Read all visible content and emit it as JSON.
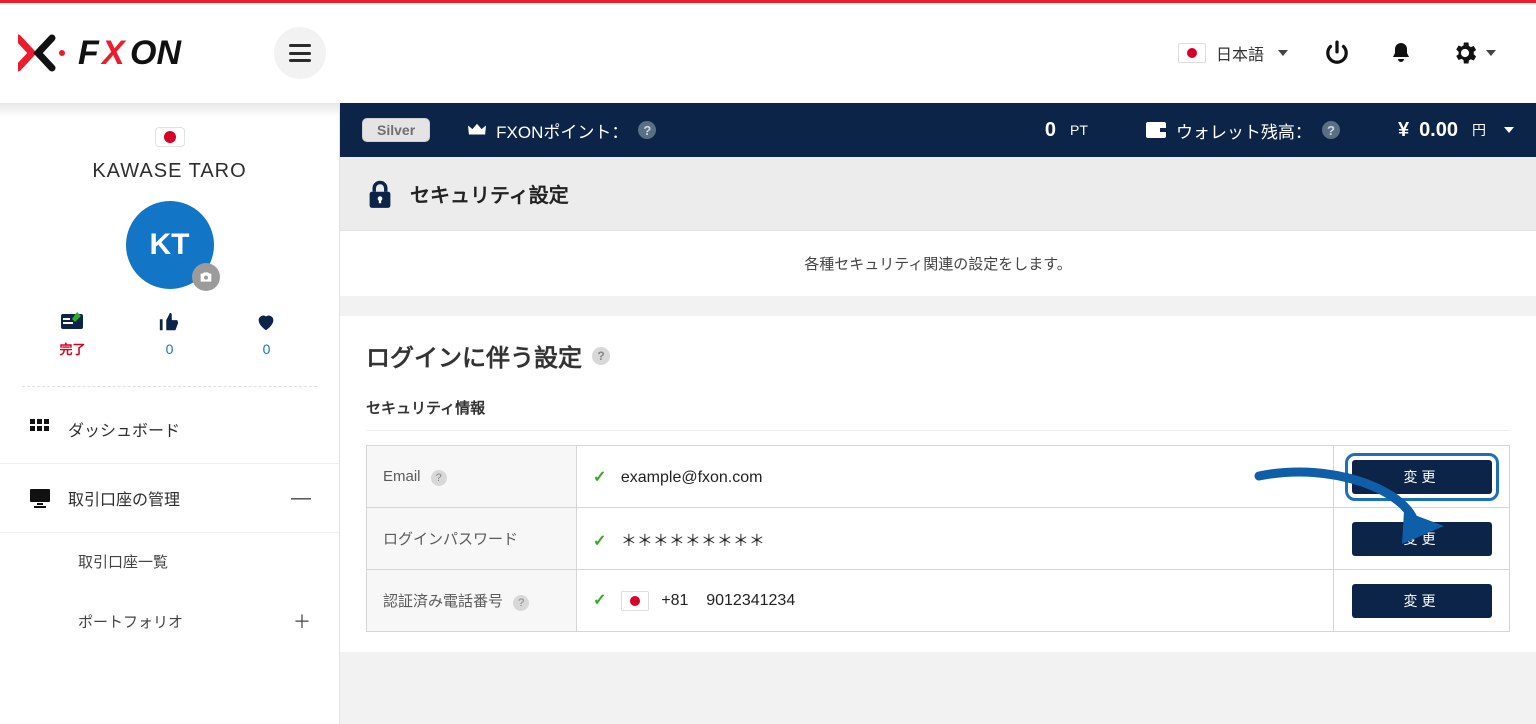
{
  "header": {
    "brand_text": "FXON",
    "language_label": "日本語"
  },
  "infobar": {
    "tier": "Silver",
    "points_label": "FXONポイント：",
    "points_value": "0",
    "points_unit": "PT",
    "wallet_label": "ウォレット残高：",
    "wallet_currency": "¥",
    "wallet_value": "0.00",
    "wallet_unit": "円"
  },
  "sidebar": {
    "user_name": "KAWASE TARO",
    "avatar_initials": "KT",
    "stats": {
      "status_label": "完了",
      "likes": "0",
      "favs": "0"
    },
    "nav": {
      "dashboard": "ダッシュボード",
      "accounts": "取引口座の管理",
      "accounts_list": "取引口座一覧",
      "portfolio": "ポートフォリオ"
    }
  },
  "main": {
    "section_icon_label": "セキュリティ設定",
    "desc": "各種セキュリティ関連の設定をします。",
    "login_settings_title": "ログインに伴う設定",
    "security_info_label": "セキュリティ情報",
    "rows": {
      "email_label": "Email",
      "email_value": "example@fxon.com",
      "password_label": "ログインパスワード",
      "password_value": "＊＊＊＊＊＊＊＊＊",
      "phone_label": "認証済み電話番号",
      "phone_cc": "+81",
      "phone_value": "9012341234",
      "change_btn": "変更"
    }
  }
}
